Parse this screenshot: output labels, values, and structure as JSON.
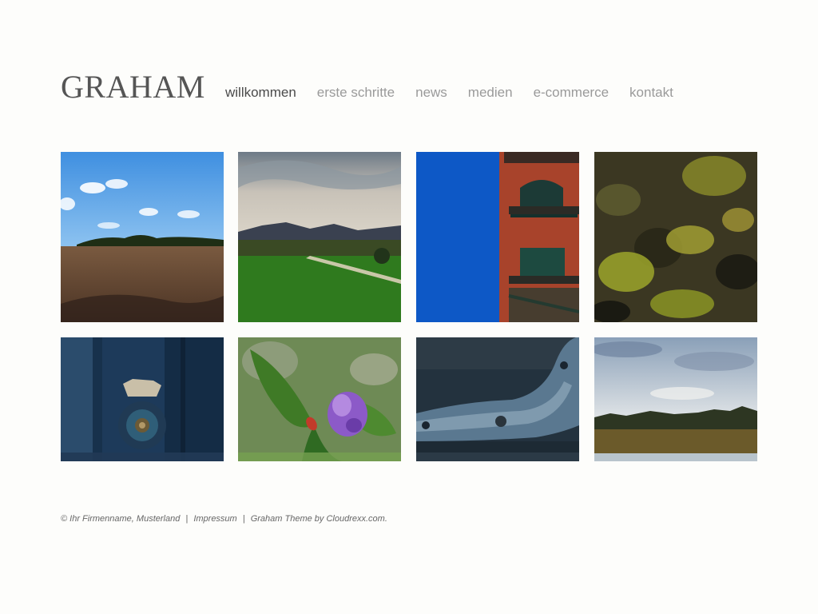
{
  "site": {
    "title": "GRAHAM"
  },
  "nav": {
    "items": [
      {
        "label": "willkommen",
        "active": true
      },
      {
        "label": "erste schritte"
      },
      {
        "label": "news"
      },
      {
        "label": "medien"
      },
      {
        "label": "e-commerce"
      },
      {
        "label": "kontakt"
      }
    ]
  },
  "gallery": {
    "images": [
      {
        "subject": "field under blue sky"
      },
      {
        "subject": "green meadow with mountains"
      },
      {
        "subject": "brick building against blue sky"
      },
      {
        "subject": "moss on rock"
      },
      {
        "subject": "blue wooden door knob"
      },
      {
        "subject": "purple flower with beetle"
      },
      {
        "subject": "weathered blue wood"
      },
      {
        "subject": "lake shore with trees"
      }
    ]
  },
  "footer": {
    "copyright": "© Ihr Firmenname, Musterland",
    "separator": "|",
    "impressum": "Impressum",
    "credit": "Graham Theme by Cloudrexx.com."
  },
  "colors": {
    "text_active": "#4a4a4a",
    "text_muted": "#9a9a9a",
    "background": "#fdfdfb"
  }
}
